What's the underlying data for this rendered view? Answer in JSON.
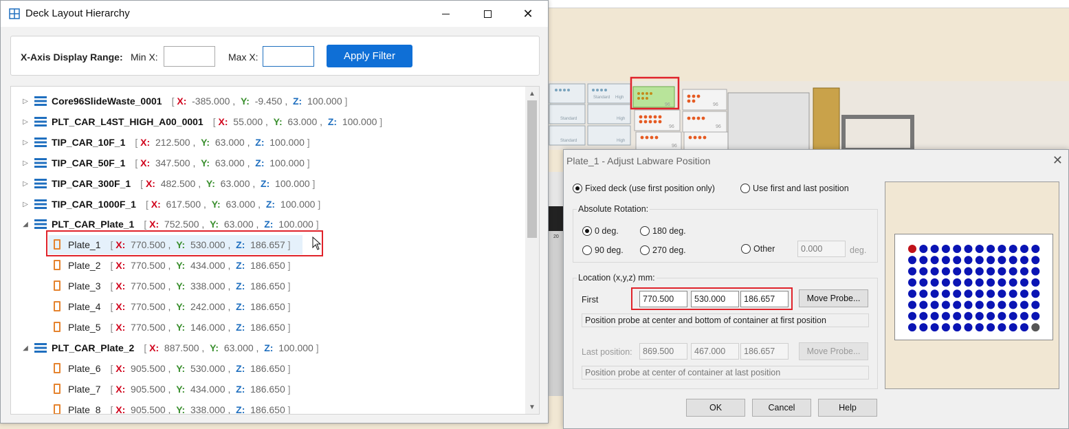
{
  "hierarchy_window": {
    "title": "Deck Layout Hierarchy",
    "filter": {
      "range_label": "X-Axis Display Range:",
      "min_label": "Min X:",
      "min_value": "",
      "max_label": "Max X:",
      "max_value": "",
      "apply_label": "Apply Filter"
    },
    "coord_keys": {
      "x": "X:",
      "y": "Y:",
      "z": "Z:"
    },
    "tree": [
      {
        "name": "Core96SlideWaste_0001",
        "type": "carrier",
        "expanded": false,
        "x": "-385.000",
        "y": "-9.450",
        "z": "100.000"
      },
      {
        "name": "PLT_CAR_L4ST_HIGH_A00_0001",
        "type": "carrier",
        "expanded": false,
        "x": "55.000",
        "y": "63.000",
        "z": "100.000"
      },
      {
        "name": "TIP_CAR_10F_1",
        "type": "carrier",
        "expanded": false,
        "x": "212.500",
        "y": "63.000",
        "z": "100.000"
      },
      {
        "name": "TIP_CAR_50F_1",
        "type": "carrier",
        "expanded": false,
        "x": "347.500",
        "y": "63.000",
        "z": "100.000"
      },
      {
        "name": "TIP_CAR_300F_1",
        "type": "carrier",
        "expanded": false,
        "x": "482.500",
        "y": "63.000",
        "z": "100.000"
      },
      {
        "name": "TIP_CAR_1000F_1",
        "type": "carrier",
        "expanded": false,
        "x": "617.500",
        "y": "63.000",
        "z": "100.000"
      },
      {
        "name": "PLT_CAR_Plate_1",
        "type": "carrier",
        "expanded": true,
        "x": "752.500",
        "y": "63.000",
        "z": "100.000"
      },
      {
        "name": "Plate_1",
        "type": "plate",
        "selected": true,
        "x": "770.500",
        "y": "530.000",
        "z": "186.657"
      },
      {
        "name": "Plate_2",
        "type": "plate",
        "x": "770.500",
        "y": "434.000",
        "z": "186.650"
      },
      {
        "name": "Plate_3",
        "type": "plate",
        "x": "770.500",
        "y": "338.000",
        "z": "186.650"
      },
      {
        "name": "Plate_4",
        "type": "plate",
        "x": "770.500",
        "y": "242.000",
        "z": "186.650"
      },
      {
        "name": "Plate_5",
        "type": "plate",
        "x": "770.500",
        "y": "146.000",
        "z": "186.650"
      },
      {
        "name": "PLT_CAR_Plate_2",
        "type": "carrier",
        "expanded": true,
        "x": "887.500",
        "y": "63.000",
        "z": "100.000"
      },
      {
        "name": "Plate_6",
        "type": "plate",
        "x": "905.500",
        "y": "530.000",
        "z": "186.650"
      },
      {
        "name": "Plate_7",
        "type": "plate",
        "x": "905.500",
        "y": "434.000",
        "z": "186.650"
      },
      {
        "name": "Plate_8",
        "type": "plate",
        "x": "905.500",
        "y": "338.000",
        "z": "186.650"
      }
    ]
  },
  "deck_view": {
    "labels": [
      "Standard",
      "High",
      "Standard",
      "High",
      "Standard",
      "High",
      "96",
      "96",
      "96",
      "96",
      "96",
      "20"
    ]
  },
  "adjust_dialog": {
    "title": "Plate_1 - Adjust Labware Position",
    "close_glyph": "✕",
    "mode_fixed": "Fixed deck (use first position only)",
    "mode_first_last": "Use first and last position",
    "rotation": {
      "title": "Absolute Rotation:",
      "opt_0": "0 deg.",
      "opt_90": "90 deg.",
      "opt_180": "180 deg.",
      "opt_270": "270 deg.",
      "opt_other": "Other",
      "other_value": "0.000",
      "other_unit": "deg."
    },
    "location": {
      "title": "Location (x,y,z) mm:",
      "first_label": "First",
      "first_x": "770.500",
      "first_y": "530.000",
      "first_z": "186.657",
      "move_probe": "Move Probe...",
      "first_hint": "Position probe at center and bottom of container at first position",
      "last_label": "Last position:",
      "last_x": "869.500",
      "last_y": "467.000",
      "last_z": "186.657",
      "last_move_probe": "Move Probe...",
      "last_hint": "Position probe at center of container at last position"
    },
    "ok": "OK",
    "cancel": "Cancel",
    "help": "Help",
    "plate_preview": {
      "rows": 8,
      "cols": 12,
      "first_well_color": "#c0121a",
      "last_well_color": "#555555",
      "well_color": "#0a14b4"
    }
  }
}
